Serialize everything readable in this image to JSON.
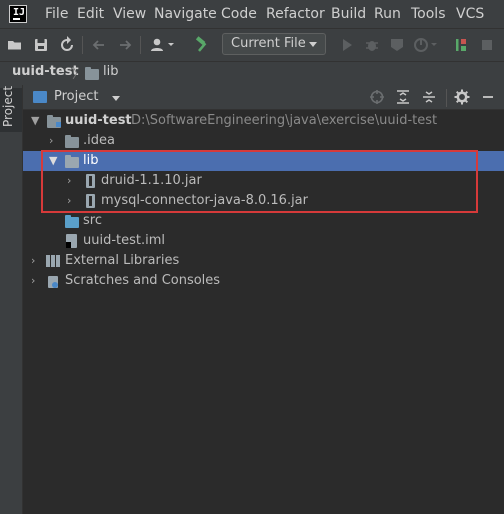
{
  "menubar": {
    "logo_text": "IJ",
    "items": [
      "File",
      "Edit",
      "View",
      "Navigate",
      "Code",
      "Refactor",
      "Build",
      "Run",
      "Tools",
      "VCS"
    ]
  },
  "toolbar": {
    "icons": [
      "open-folder-icon",
      "save-icon",
      "sync-icon",
      "back-arrow-icon",
      "forward-arrow-icon",
      "user-icon",
      "hammer-icon",
      "run-icon",
      "debug-icon",
      "coverage-icon",
      "profile-icon",
      "stop-icon"
    ],
    "run_config": "Current File"
  },
  "breadcrumb": {
    "project": "uuid-test",
    "separator": "〉",
    "folder": "lib"
  },
  "side_stripe": {
    "tab_label": "Project"
  },
  "panel": {
    "title": "Project",
    "icons": [
      "locate-icon",
      "expand-all-icon",
      "collapse-all-icon",
      "settings-icon",
      "hide-icon"
    ]
  },
  "tree": {
    "root": {
      "name": "uuid-test",
      "path": "D:\\SoftwareEngineering\\java\\exercise\\uuid-test"
    },
    "idea": ".idea",
    "lib": "lib",
    "jars": [
      "druid-1.1.10.jar",
      "mysql-connector-java-8.0.16.jar"
    ],
    "src": "src",
    "iml": "uuid-test.iml",
    "external": "External Libraries",
    "scratches": "Scratches and Consoles"
  },
  "colors": {
    "background": "#2b2b2b",
    "chrome": "#3c3f41",
    "selection": "#4b6eaf",
    "highlight_box": "#d63a3a",
    "folder": "#87939a",
    "source_folder": "#5a9fc9",
    "run_green": "#59a869"
  }
}
